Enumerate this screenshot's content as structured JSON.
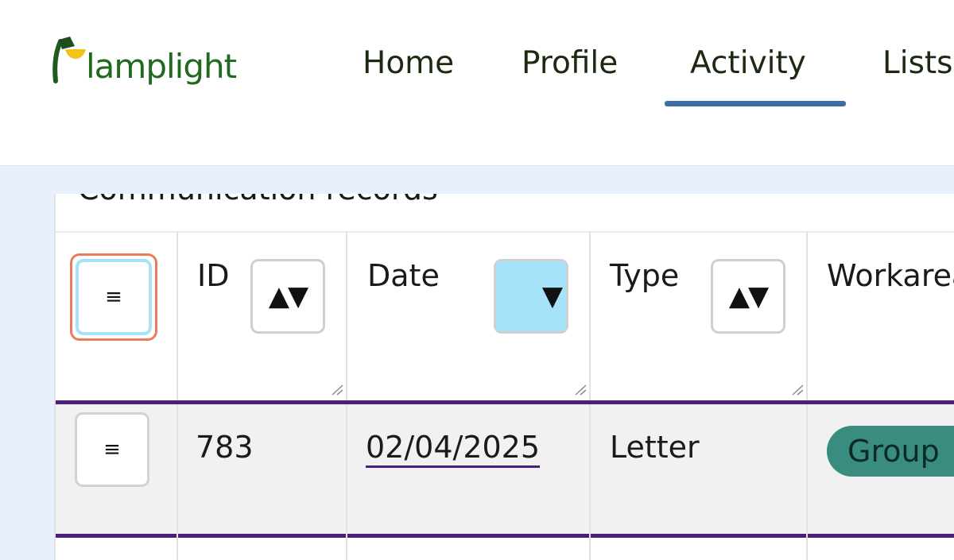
{
  "app": {
    "logo_text": "lamplight"
  },
  "nav": {
    "items": [
      {
        "label": "Home"
      },
      {
        "label": "Profile"
      },
      {
        "label": "Activity",
        "active": true
      },
      {
        "label": "Lists"
      }
    ]
  },
  "panel": {
    "title": "Communication records"
  },
  "table": {
    "columns": [
      {
        "label": "",
        "control": "menu-icon"
      },
      {
        "label": "ID",
        "sort": "both"
      },
      {
        "label": "Date",
        "sort": "desc"
      },
      {
        "label": "Type",
        "sort": "both"
      },
      {
        "label": "Workarea"
      }
    ],
    "rows": [
      {
        "id": "783",
        "date": "02/04/2025",
        "type": "Letter",
        "workarea": "Group"
      }
    ]
  },
  "icons": {
    "menu": "hamburger-icon",
    "sort_both": "sort-up-down-icon",
    "sort_desc": "sort-down-icon"
  },
  "colors": {
    "accent": "#3e6ea6",
    "row_border": "#4b1f7a",
    "active_sort_bg": "#a5e3fb",
    "focus_outline": "#ee7a5c",
    "pill_bg": "#3b8c80",
    "brand_green": "#1f6a1f"
  }
}
